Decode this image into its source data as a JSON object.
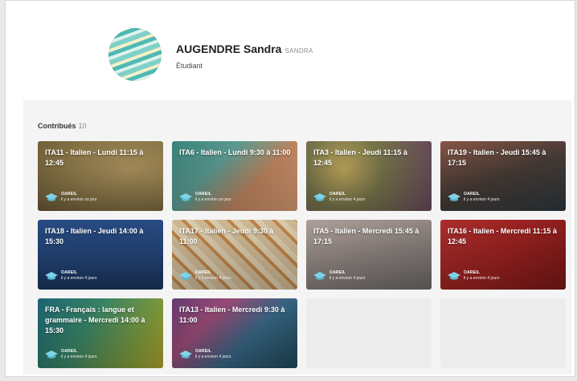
{
  "profile": {
    "name": "AUGENDRE Sandra",
    "login": "SANDRA",
    "role": "Étudiant",
    "avatar_colors": [
      "#7fd0c8",
      "#f3f0c9",
      "#4fb9b4",
      "#dff2ec"
    ]
  },
  "contributions": {
    "label": "Contribués",
    "count": "10",
    "items": [
      {
        "title": "ITA11 - Italien - Lundi 11:15 à 12:45",
        "author": "OAREIL",
        "time": "il y a environ un jour"
      },
      {
        "title": "ITA6 - Italien - Lundi 9:30 à 11:00",
        "author": "OAREIL",
        "time": "il y a environ un jour"
      },
      {
        "title": "ITA3 - Italien - Jeudi 11:15 à 12:45",
        "author": "OAREIL",
        "time": "il y a environ 4 jours"
      },
      {
        "title": "ITA19 - Italien - Jeudi 15:45 à 17:15",
        "author": "OAREIL",
        "time": "il y a environ 4 jours"
      },
      {
        "title": "ITA18 - Italien - Jeudi 14:00 à 15:30",
        "author": "OAREIL",
        "time": "il y a environ 4 jours"
      },
      {
        "title": "ITA17 - Italien - Jeudi 9:30 à 11:00",
        "author": "OAREIL",
        "time": "il y a environ 4 jours"
      },
      {
        "title": "ITA5 - Italien - Mercredi 15:45 à 17:15",
        "author": "OAREIL",
        "time": "il y a environ 4 jours"
      },
      {
        "title": "ITA16 - Italien - Mercredi 11:15 à 12:45",
        "author": "OAREIL",
        "time": "il y a environ 4 jours"
      },
      {
        "title": "FRA - Français : langue et grammaire - Mercredi 14:00 à 15:30",
        "author": "OAREIL",
        "time": "il y a environ 4 jours"
      },
      {
        "title": "ITA13 - Italien - Mercredi 9:30 à 11:00",
        "author": "OAREIL",
        "time": "il y a environ 4 jours"
      }
    ]
  },
  "icons": {
    "author": "hat-icon"
  }
}
